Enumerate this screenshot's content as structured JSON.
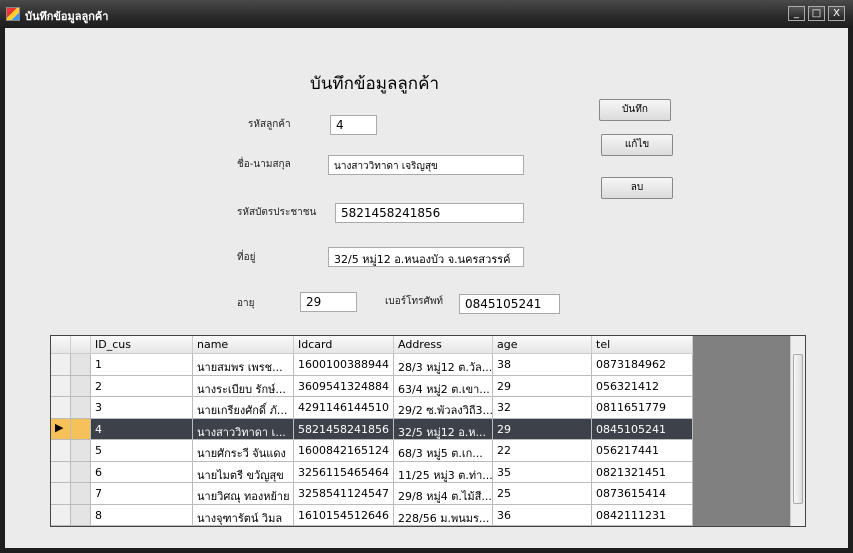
{
  "window": {
    "title": "บันทึกข้อมูลลูกค้า",
    "minimize": "_",
    "maximize": "□",
    "close": "X"
  },
  "form": {
    "heading": "บันทึกข้อมูลลูกค้า",
    "customer_id_label": "รหัสลูกค้า",
    "customer_id": "4",
    "name_label": "ชื่อ-นามสกุล",
    "name": "นางสาววิทาดา  เจริญสุข",
    "idcard_label": "รหัสบัตรประชาชน",
    "idcard": "5821458241856",
    "address_label": "ที่อยู่",
    "address": "32/5 หมู่12 อ.หนองบัว จ.นครสวรรค์",
    "age_label": "อายุ",
    "age": "29",
    "tel_label": "เบอร์โทรศัพท์",
    "tel": "0845105241",
    "save_label": "บันทึก",
    "edit_label": "แก้ไข",
    "delete_label": "ลบ"
  },
  "grid": {
    "columns": [
      "ID_cus",
      "name",
      "Idcard",
      "Address",
      "age",
      "tel"
    ],
    "rows": [
      [
        "1",
        "นายสมพร เพรช...",
        "1600100388944",
        "28/3 หมู่12 ต.วัล...",
        "38",
        "0873184962"
      ],
      [
        "2",
        "นางระเบียบ รักษ์...",
        "3609541324884",
        "63/4 หมู่2 ต.เขา...",
        "29",
        "056321412"
      ],
      [
        "3",
        "นายเกรียงศักดิ์ ภั...",
        "4291146144510",
        "29/2 ซ.พัวลงวิถี3...",
        "32",
        "0811651779"
      ],
      [
        "4",
        "นางสาววิทาดา  เ...",
        "5821458241856",
        "32/5 หมู่12 อ.ห...",
        "29",
        "0845105241"
      ],
      [
        "5",
        "นายศักระวี จันแดง",
        "1600842165124",
        "68/3 หมู่5 ต.เก...",
        "22",
        "056217441"
      ],
      [
        "6",
        "นายไมตรี ขวัญสุข",
        "3256115465464",
        "11/25 หมู่3 ต.ท่า...",
        "35",
        "0821321451"
      ],
      [
        "7",
        "นายวิศณุ ทองหย้าย",
        "3258541124547",
        "29/8 หมู่4 ต.ไม้สี...",
        "25",
        "0873615414"
      ],
      [
        "8",
        "นางจุฑารัตน์ วิมล",
        "1610154512646",
        "228/56 ม.พนมร...",
        "36",
        "0842111231"
      ]
    ],
    "selected_row_marker": "▶"
  }
}
